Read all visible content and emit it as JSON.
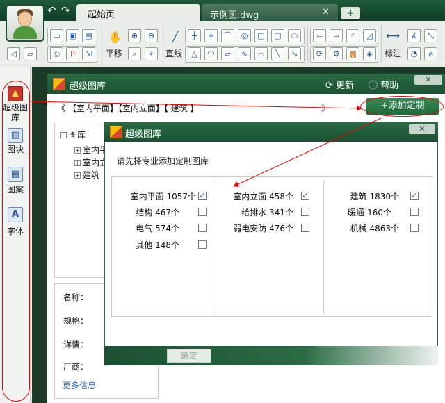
{
  "titlebar": {
    "tabs": [
      {
        "label": "起始页",
        "active": true
      },
      {
        "label": "示例图.dwg",
        "active": false
      }
    ],
    "add_tab_label": "+",
    "close_label": "✕"
  },
  "toolbar": {
    "pan_label": "平移",
    "line_label": "直线",
    "dimension_label": "标注"
  },
  "leftstrip": {
    "items": [
      {
        "label": "超级图库",
        "icon": "picture-icon"
      },
      {
        "label": "图块",
        "icon": "books-icon"
      },
      {
        "label": "图案",
        "icon": "hatch-icon"
      },
      {
        "label": "字体",
        "icon": "font-icon"
      }
    ]
  },
  "library": {
    "title": "超级图库",
    "update_label": "更新",
    "help_label": "帮助",
    "breadcrumb": "《 【室内平面】【室内立面】【   建筑    】",
    "breadcrumb_next": "》",
    "add_custom_label": "+添加定制",
    "tree": {
      "root": "图库",
      "children": [
        "室内平",
        "室内立",
        "建筑"
      ]
    },
    "info": {
      "name_label": "名称：",
      "spec_label": "规格：",
      "detail_label": "详情：",
      "vendor_label": "厂商：",
      "more_label": "更多信息"
    }
  },
  "dialog": {
    "title": "超级图库",
    "hint": "请先择专业添加定制图库",
    "ok_label": "确定",
    "columns": [
      [
        {
          "label": "室内平面 1057个",
          "checked": true
        },
        {
          "label": "结构 467个",
          "checked": false
        },
        {
          "label": "电气 574个",
          "checked": false
        },
        {
          "label": "其他 148个",
          "checked": false
        }
      ],
      [
        {
          "label": "室内立面 458个",
          "checked": true
        },
        {
          "label": "给排水 341个",
          "checked": false
        },
        {
          "label": "弱电安防 476个",
          "checked": false
        }
      ],
      [
        {
          "label": "建筑 1830个",
          "checked": true
        },
        {
          "label": "暖通 160个",
          "checked": false
        },
        {
          "label": "机械 4863个",
          "checked": false
        }
      ]
    ]
  },
  "colors": {
    "accent_green": "#1b5133",
    "annotation_red": "#e00000",
    "link_blue": "#2a6fc4"
  }
}
